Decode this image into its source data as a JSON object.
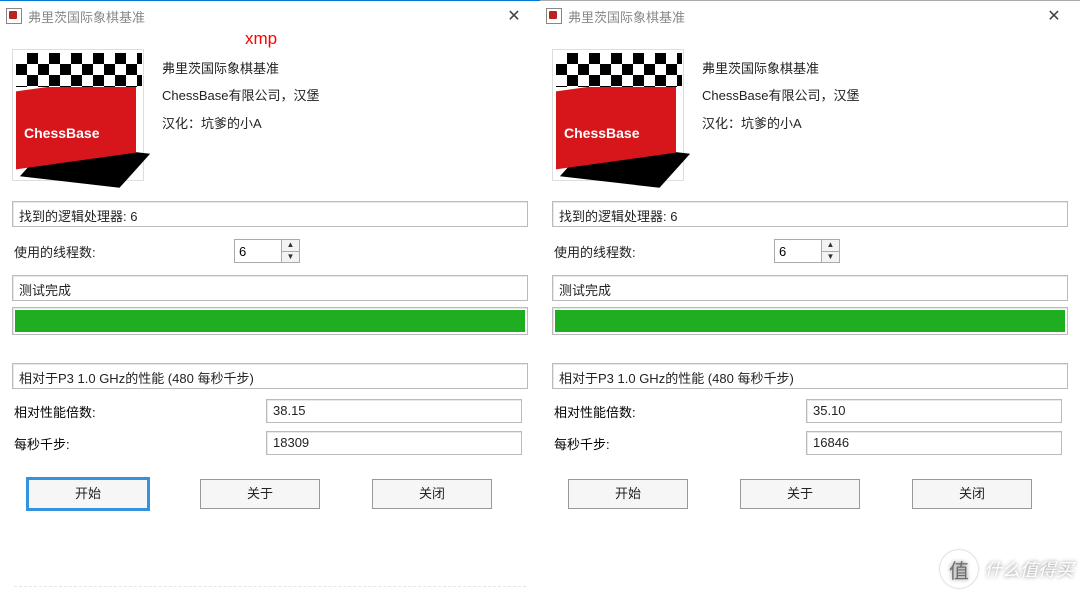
{
  "annotation": "xmp",
  "logo_label": "ChessBase",
  "watermark_char": "值",
  "watermark_text": "什么值得买",
  "left": {
    "title": "弗里茨国际象棋基准",
    "header": {
      "line1": "弗里茨国际象棋基准",
      "line2": "ChessBase有限公司，汉堡",
      "line3": "汉化：坑爹的小A"
    },
    "processors_label": "找到的逻辑处理器: 6",
    "threads_label": "使用的线程数:",
    "threads_value": "6",
    "status_label": "测试完成",
    "relative_label": "相对于P3 1.0 GHz的性能 (480 每秒千步)",
    "multiplier_label": "相对性能倍数:",
    "multiplier_value": "38.15",
    "knps_label": "每秒千步:",
    "knps_value": "18309",
    "btn_start": "开始",
    "btn_about": "关于",
    "btn_close": "关闭"
  },
  "right": {
    "title": "弗里茨国际象棋基准",
    "header": {
      "line1": "弗里茨国际象棋基准",
      "line2": "ChessBase有限公司，汉堡",
      "line3": "汉化：坑爹的小A"
    },
    "processors_label": "找到的逻辑处理器: 6",
    "threads_label": "使用的线程数:",
    "threads_value": "6",
    "status_label": "测试完成",
    "relative_label": "相对于P3 1.0 GHz的性能 (480 每秒千步)",
    "multiplier_label": "相对性能倍数:",
    "multiplier_value": "35.10",
    "knps_label": "每秒千步:",
    "knps_value": "16846",
    "btn_start": "开始",
    "btn_about": "关于",
    "btn_close": "关闭"
  }
}
